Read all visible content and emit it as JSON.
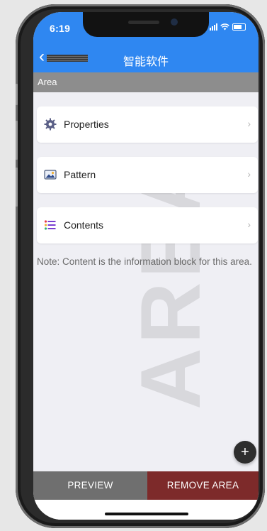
{
  "status_bar": {
    "time": "6:19"
  },
  "nav": {
    "title": "智能软件",
    "back_icon": "chevron-left-icon"
  },
  "section": {
    "title": "Area"
  },
  "watermark": "AREA",
  "menu": [
    {
      "label": "Properties",
      "icon": "gear-icon"
    },
    {
      "label": "Pattern",
      "icon": "image-icon"
    },
    {
      "label": "Contents",
      "icon": "list-icon"
    }
  ],
  "note": "Note: Content is the information block for this area.",
  "fab": {
    "label": "+"
  },
  "bottom": {
    "preview_label": "PREVIEW",
    "remove_label": "REMOVE AREA"
  },
  "colors": {
    "nav_bg": "#2f87f1",
    "section_bg": "#8d8d8d",
    "preview_bg": "#6f6f6f",
    "remove_bg": "#7d2a2a"
  }
}
